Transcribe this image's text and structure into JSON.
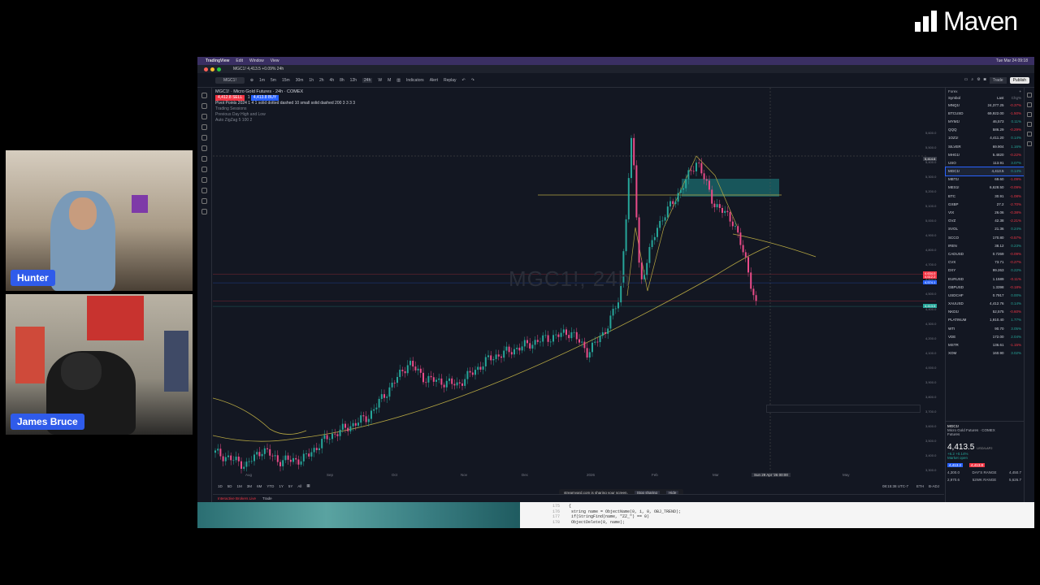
{
  "brand": {
    "logo_text": "Maven",
    "logo_color": "#ffffff"
  },
  "participants": [
    {
      "name": "Hunter"
    },
    {
      "name": "James Bruce"
    }
  ],
  "mac_menu": {
    "items": [
      "TradingView",
      "Edit",
      "Window",
      "View"
    ],
    "clock": "Tue Mar 24 09:18"
  },
  "browser_tab": {
    "title": "MGC1! 4,413.5 +0.09% 24h"
  },
  "toolbar": {
    "symbol": "MGC1!",
    "intervals": [
      "1m",
      "5m",
      "15m",
      "30m",
      "1h",
      "2h",
      "4h",
      "8h",
      "12h",
      "24h",
      "W",
      "M"
    ],
    "indicators_label": "Indicators",
    "alert_label": "Alert",
    "replay_label": "Replay",
    "trade_label": "Trade",
    "publish_label": "Publish"
  },
  "legend": {
    "title": "MGC1! · Micro Gold Futures · 24h · COMEX",
    "sell_price": "4,412.8",
    "buy_price": "4,413.8",
    "sell_label": "SELL",
    "buy_label": "BUY",
    "spread": "1",
    "line1": "Pivot Points 2024 1 4 1 solid dotted dashed 10 small solid dashed 200 3 3 3 3",
    "line2": "Trading Sessions",
    "line3": "Previous Day High and Low",
    "line4": "Auto ZigZag 5 100 2"
  },
  "chart_watermark": "MGC1!, 24h",
  "chart_data": {
    "type": "line",
    "series": [
      {
        "x": [
          "Aug",
          "Sep",
          "Oct",
          "Nov",
          "Dec",
          "2026",
          "Feb",
          "Mar"
        ],
        "values": [
          3420,
          3640,
          4050,
          4000,
          4300,
          4500,
          5400,
          4413
        ]
      }
    ],
    "xlabels": [
      "Aug",
      "Sep",
      "Oct",
      "Nov",
      "Dec",
      "2026",
      "Feb",
      "Mar",
      "Apr",
      "May"
    ],
    "yticks": [
      "5,600.0",
      "5,500.0",
      "5,400.0",
      "5,300.0",
      "5,200.0",
      "5,100.0",
      "5,000.0",
      "4,900.0",
      "4,800.0",
      "4,700.0",
      "4,600.0",
      "4,500.0",
      "4,400.0",
      "4,300.0",
      "4,200.0",
      "4,100.0",
      "4,000.0",
      "3,900.0",
      "3,800.0",
      "3,700.0",
      "3,600.0",
      "3,500.0",
      "3,400.0",
      "3,300.0"
    ],
    "ylim": [
      3300,
      5600
    ],
    "up_color": "#26a69a",
    "down_color": "#ea4c89"
  },
  "price_labels": [
    {
      "text": "5,414.6",
      "color": "#363a45"
    },
    {
      "text": "4,634.0",
      "color": "#f23645"
    },
    {
      "text": "4,612.2",
      "color": "#f23645"
    },
    {
      "text": "4,574.1",
      "color": "#2962ff"
    },
    {
      "text": "4,413.5",
      "color": "#26a69a"
    }
  ],
  "crosshair_date": "Sun 29 Apr '26",
  "crosshair_time": "00:00",
  "ranges": [
    "1D",
    "5D",
    "1M",
    "3M",
    "6M",
    "YTD",
    "1Y",
    "5Y",
    "All"
  ],
  "status_time": "08:15:38 UTC-7",
  "session": "ETH",
  "adj": "B-ADJ",
  "bottom_tabs": [
    "Interactive Brokers Live",
    "Trade"
  ],
  "share_bar": {
    "text": "streamyard.com is sharing your screen.",
    "stop": "Stop sharing",
    "hide": "Hide"
  },
  "watchlist": {
    "title": "Forex",
    "col_symbol": "Symbol",
    "col_last": "Last",
    "col_chg": "Chg%",
    "rows": [
      {
        "s": "MNQ1!",
        "l": "24,377.25",
        "c": "-0.37%",
        "dir": "dn"
      },
      {
        "s": "BTCUSD",
        "l": "69,922.00",
        "c": "-1.50%",
        "dir": "dn"
      },
      {
        "s": "MYM1!",
        "l": "46,573",
        "c": "0.11%",
        "dir": "up"
      },
      {
        "s": "QQQ",
        "l": "586.29",
        "c": "-0.29%",
        "dir": "dn"
      },
      {
        "s": "1OZ1!",
        "l": "4,411.20",
        "c": "0.14%",
        "dir": "up"
      },
      {
        "s": "SILVER",
        "l": "69.904",
        "c": "1.16%",
        "dir": "up"
      },
      {
        "s": "MHG1!",
        "l": "5.4820",
        "c": "-0.22%",
        "dir": "dn"
      },
      {
        "s": "USO",
        "l": "113.91",
        "c": "3.07%",
        "dir": "up"
      },
      {
        "s": "MGC1!",
        "l": "4,413.5",
        "c": "0.14%",
        "dir": "up",
        "sel": true
      },
      {
        "s": "MBT1!",
        "l": "69.60",
        "c": "-1.09%",
        "dir": "dn"
      },
      {
        "s": "MES1!",
        "l": "6,628.50",
        "c": "-0.09%",
        "dir": "dn"
      },
      {
        "s": "BTC",
        "l": "30.91",
        "c": "-1.08%",
        "dir": "dn"
      },
      {
        "s": "GXBP",
        "l": "27.2",
        "c": "-2.70%",
        "dir": "dn"
      },
      {
        "s": "VIX",
        "l": "26.06",
        "c": "-0.38%",
        "dir": "dn"
      },
      {
        "s": "GVZ",
        "l": "42.38",
        "c": "-2.21%",
        "dir": "dn"
      },
      {
        "s": "SVOL",
        "l": "21.36",
        "c": "0.24%",
        "dir": "up"
      },
      {
        "s": "SCCO",
        "l": "170.80",
        "c": "-0.57%",
        "dir": "dn"
      },
      {
        "s": "IREN",
        "l": "38.12",
        "c": "0.23%",
        "dir": "up"
      },
      {
        "s": "CADUSD",
        "l": "0.7269",
        "c": "-0.09%",
        "dir": "dn"
      },
      {
        "s": "CVX",
        "l": "73.71",
        "c": "-0.27%",
        "dir": "dn"
      },
      {
        "s": "DXY",
        "l": "99.263",
        "c": "0.22%",
        "dir": "up"
      },
      {
        "s": "EURUSD",
        "l": "1.1589",
        "c": "-0.11%",
        "dir": "dn"
      },
      {
        "s": "GBPUSD",
        "l": "1.3398",
        "c": "-0.18%",
        "dir": "dn"
      },
      {
        "s": "USDCHF",
        "l": "0.7917",
        "c": "0.00%",
        "dir": "up"
      },
      {
        "s": "XAUUSD",
        "l": "4,412.76",
        "c": "0.14%",
        "dir": "up"
      },
      {
        "s": "NKD1!",
        "l": "52,575",
        "c": "-0.60%",
        "dir": "dn"
      },
      {
        "s": "PLATINUM",
        "l": "1,910.40",
        "c": "1.77%",
        "dir": "up"
      },
      {
        "s": "WTI",
        "l": "90.70",
        "c": "3.05%",
        "dir": "up"
      },
      {
        "s": "VDE",
        "l": "172.00",
        "c": "2.04%",
        "dir": "up"
      },
      {
        "s": "MSTR",
        "l": "136.61",
        "c": "-1.15%",
        "dir": "dn"
      },
      {
        "s": "XOM",
        "l": "160.90",
        "c": "3.02%",
        "dir": "up"
      }
    ]
  },
  "detail": {
    "symbol": "MGC1!",
    "name": "Micro Gold Futures · COMEX",
    "type": "Futures",
    "price": "4,413.5",
    "unit": "USD/LAP2",
    "change": "+6.2  +0.14%",
    "status": "Market open",
    "bid": "4,413.2",
    "ask": "4,413.8",
    "day_low": "4,300.0",
    "day_range_label": "DAY'S RANGE",
    "day_high": "4,450.7",
    "year_low": "2,970.6",
    "year_range_label": "52WK RANGE",
    "year_high": "5,626.7"
  },
  "code_lines": [
    {
      "n": "175",
      "t": "{"
    },
    {
      "n": "176",
      "t": "   string name = ObjectName(0, i, 0, OBJ_TREND);"
    },
    {
      "n": "177",
      "t": "   if(StringFind(name, \"ZZ_\") == 0)"
    },
    {
      "n": "178",
      "t": "      ObjectDelete(0, name);"
    }
  ]
}
